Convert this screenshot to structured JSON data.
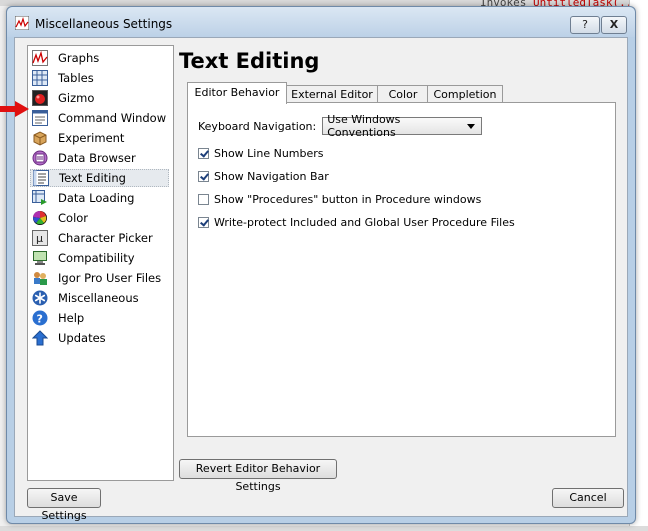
{
  "background": {
    "code_fragment_prefix": "Invokes",
    "code_fragment_red": "UntitledTask(..."
  },
  "window": {
    "title": "Miscellaneous Settings",
    "help_label": "?",
    "close_label": "X"
  },
  "sidebar": {
    "items": [
      {
        "label": "Graphs",
        "icon": "graphs-icon"
      },
      {
        "label": "Tables",
        "icon": "tables-icon"
      },
      {
        "label": "Gizmo",
        "icon": "gizmo-icon"
      },
      {
        "label": "Command Window",
        "icon": "command-window-icon"
      },
      {
        "label": "Experiment",
        "icon": "experiment-icon"
      },
      {
        "label": "Data Browser",
        "icon": "data-browser-icon"
      },
      {
        "label": "Text Editing",
        "icon": "text-editing-icon",
        "selected": true
      },
      {
        "label": "Data Loading",
        "icon": "data-loading-icon"
      },
      {
        "label": "Color",
        "icon": "color-wheel-icon"
      },
      {
        "label": "Character Picker",
        "icon": "character-picker-icon"
      },
      {
        "label": "Compatibility",
        "icon": "compatibility-icon"
      },
      {
        "label": "Igor Pro User Files",
        "icon": "user-files-icon"
      },
      {
        "label": "Miscellaneous",
        "icon": "miscellaneous-icon"
      },
      {
        "label": "Help",
        "icon": "help-icon"
      },
      {
        "label": "Updates",
        "icon": "updates-icon"
      }
    ]
  },
  "panel": {
    "title": "Text Editing",
    "tabs": [
      {
        "label": "Editor Behavior",
        "active": true
      },
      {
        "label": "External Editor",
        "active": false
      },
      {
        "label": "Color",
        "active": false
      },
      {
        "label": "Completion",
        "active": false
      }
    ],
    "keyboard_navigation_label": "Keyboard Navigation:",
    "keyboard_navigation_value": "Use Windows Conventions",
    "checkboxes": [
      {
        "label": "Show Line Numbers",
        "checked": true
      },
      {
        "label": "Show Navigation Bar",
        "checked": true
      },
      {
        "label": "Show \"Procedures\" button in Procedure windows",
        "checked": false
      },
      {
        "label": "Write-protect Included and Global User Procedure Files",
        "checked": true
      }
    ],
    "revert_button": "Revert Editor Behavior Settings"
  },
  "footer": {
    "save_button": "Save Settings",
    "cancel_button": "Cancel"
  },
  "colors": {
    "titlebar": "#bcd1e7",
    "pointer_arrow": "#e01010",
    "selection": "#e6eaee"
  }
}
